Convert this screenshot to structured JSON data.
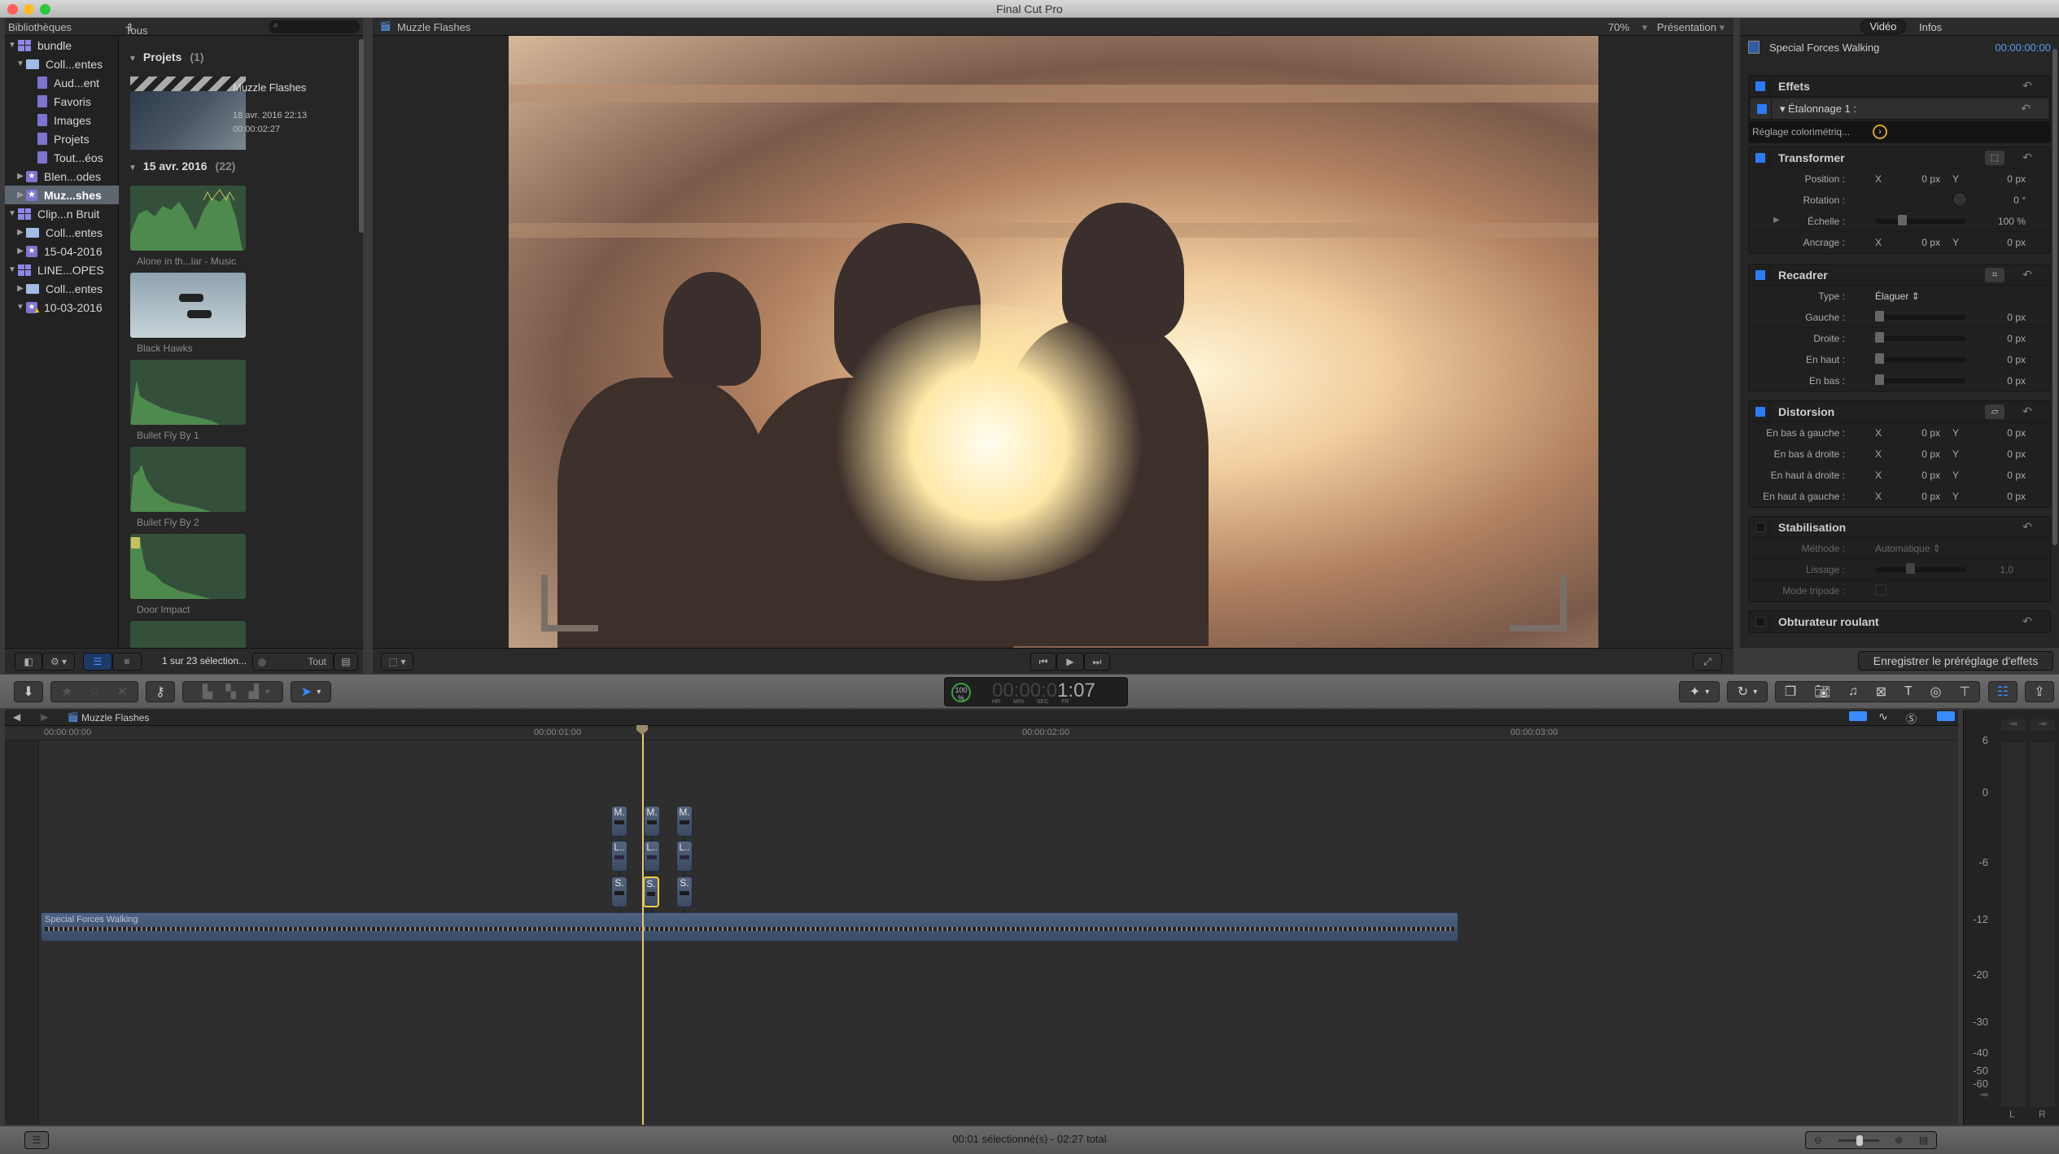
{
  "window": {
    "title": "Final Cut Pro"
  },
  "library_header": {
    "title": "Bibliothèques",
    "filter": "Tous les plans",
    "search_placeholder": ""
  },
  "sidebar": {
    "items": [
      {
        "label": "bundle",
        "type": "library",
        "expanded": true
      },
      {
        "label": "Coll...entes",
        "type": "folder",
        "expanded": true
      },
      {
        "label": "Aud...ent",
        "type": "keyword"
      },
      {
        "label": "Favoris",
        "type": "keyword"
      },
      {
        "label": "Images",
        "type": "keyword"
      },
      {
        "label": "Projets",
        "type": "keyword"
      },
      {
        "label": "Tout...éos",
        "type": "keyword"
      },
      {
        "label": "Blen...odes",
        "type": "event",
        "expanded": false
      },
      {
        "label": "Muz...shes",
        "type": "event",
        "expanded": false,
        "selected": true
      },
      {
        "label": "Clip...n Bruit",
        "type": "library",
        "expanded": true
      },
      {
        "label": "Coll...entes",
        "type": "folder",
        "expanded": false
      },
      {
        "label": "15-04-2016",
        "type": "event",
        "expanded": false
      },
      {
        "label": "LINE...OPES",
        "type": "library",
        "expanded": true
      },
      {
        "label": "Coll...entes",
        "type": "folder",
        "expanded": false
      },
      {
        "label": "10-03-2016",
        "type": "event",
        "expanded": true,
        "warning": true
      }
    ]
  },
  "browser": {
    "projects_group": {
      "label": "Projets",
      "count": "(1)"
    },
    "project": {
      "name": "Muzzle Flashes",
      "date": "18 avr. 2016 22:13",
      "duration": "00:00:02:27"
    },
    "date_group": {
      "label": "15 avr. 2016",
      "count": "(22)"
    },
    "clips": [
      {
        "name": "Alone in th...lar - Music",
        "kind": "audio"
      },
      {
        "name": "Black Hawks",
        "kind": "video"
      },
      {
        "name": "Bullet Fly By 1",
        "kind": "audio"
      },
      {
        "name": "Bullet Fly By 2",
        "kind": "audio"
      },
      {
        "name": "Door Impact",
        "kind": "audio"
      }
    ],
    "footer": {
      "selection": "1 sur 23 sélection...",
      "duration_filter": "Tout"
    }
  },
  "viewer": {
    "title": "Muzzle Flashes",
    "zoom": "70%",
    "presentation": "Présentation"
  },
  "inspector": {
    "tabs": [
      "Vidéo",
      "Infos"
    ],
    "active_tab": "Vidéo",
    "clip_name": "Special Forces Walking",
    "timecode": "00:00:00:00",
    "effects": {
      "label": "Effets",
      "sub": "Étalonnage 1 :",
      "color_row": "Réglage colorimétriq..."
    },
    "transform": {
      "label": "Transformer",
      "position": {
        "label": "Position :",
        "x": "0",
        "y": "0",
        "unit": "px"
      },
      "rotation": {
        "label": "Rotation :",
        "value": "0",
        "unit": "°"
      },
      "scale": {
        "label": "Échelle :",
        "value": "100",
        "unit": "%"
      },
      "anchor": {
        "label": "Ancrage :",
        "x": "0",
        "y": "0",
        "unit": "px"
      }
    },
    "crop": {
      "label": "Recadrer",
      "type": {
        "label": "Type :",
        "value": "Élaguer"
      },
      "rows": [
        {
          "label": "Gauche :",
          "value": "0",
          "unit": "px"
        },
        {
          "label": "Droite :",
          "value": "0",
          "unit": "px"
        },
        {
          "label": "En haut :",
          "value": "0",
          "unit": "px"
        },
        {
          "label": "En bas :",
          "value": "0",
          "unit": "px"
        }
      ]
    },
    "distort": {
      "label": "Distorsion",
      "rows": [
        {
          "label": "En bas à gauche :",
          "x": "0",
          "y": "0",
          "unit": "px"
        },
        {
          "label": "En bas à droite :",
          "x": "0",
          "y": "0",
          "unit": "px"
        },
        {
          "label": "En haut à droite :",
          "x": "0",
          "y": "0",
          "unit": "px"
        },
        {
          "label": "En haut à gauche :",
          "x": "0",
          "y": "0",
          "unit": "px"
        }
      ]
    },
    "stabilization": {
      "label": "Stabilisation",
      "method_label": "Méthode :",
      "method": "Automatique",
      "smoothing_label": "Lissage :",
      "smoothing": "1,0",
      "tripod_label": "Mode tripode :"
    },
    "rolling_shutter": {
      "label": "Obturateur roulant"
    },
    "save_preset": "Enregistrer le préréglage d'effets"
  },
  "axis_labels": {
    "x": "X",
    "y": "Y"
  },
  "toolbar": {
    "timecode": {
      "percent": "100",
      "percent_sign": "%",
      "dim": "00:00:0",
      "bright": "1:07",
      "units": [
        "HR",
        "MIN",
        "SEC",
        "FR"
      ]
    }
  },
  "timeline": {
    "project": "Muzzle Flashes",
    "ruler": [
      "00:00:00:00",
      "00:00:01:00",
      "00:00:02:00",
      "00:00:03:00"
    ],
    "main_clip": "Special Forces Walking",
    "connected": [
      {
        "labels": [
          "M.",
          "L..",
          "S."
        ],
        "selected": false
      },
      {
        "labels": [
          "M.",
          "L..",
          "S."
        ],
        "selected": true
      },
      {
        "labels": [
          "M.",
          "L..",
          "S."
        ],
        "selected": false
      }
    ]
  },
  "meters": {
    "peak_l": "-∞",
    "peak_r": "-∞",
    "scale": [
      "6",
      "0",
      "-6",
      "-12",
      "-20",
      "-30",
      "-40",
      "-50",
      "-60",
      "-∞"
    ],
    "channels": [
      "L",
      "R"
    ]
  },
  "status": {
    "text": "00:01 sélectionné(s) - 02:27 total"
  },
  "colors": {
    "accent": "#2d7cf6",
    "playhead": "#e8c870",
    "clip": "#4d6282",
    "selection": "#f0d040",
    "timecode": "#5b9cf0"
  }
}
